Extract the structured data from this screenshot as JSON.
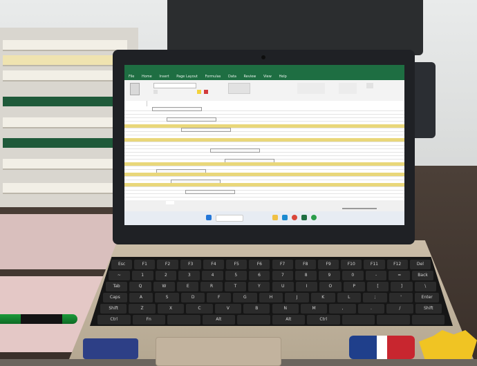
{
  "screen": {
    "app_title": "",
    "ribbon_tabs": [
      "File",
      "Home",
      "Insert",
      "Page Layout",
      "Formulas",
      "Data",
      "Review",
      "View",
      "Help"
    ],
    "sheet_tabs": [
      "",
      "",
      "",
      "",
      ""
    ],
    "accent_color": "#1e6e42",
    "highlight_row_color": "#e9d77a"
  },
  "icons": [
    "windows-start-icon",
    "search-icon",
    "file-explorer-icon",
    "edge-icon",
    "excel-icon"
  ],
  "keyboard": {
    "row1": [
      "Esc",
      "F1",
      "F2",
      "F3",
      "F4",
      "F5",
      "F6",
      "F7",
      "F8",
      "F9",
      "F10",
      "F11",
      "F12",
      "Del"
    ],
    "row2": [
      "~",
      "1",
      "2",
      "3",
      "4",
      "5",
      "6",
      "7",
      "8",
      "9",
      "0",
      "-",
      "=",
      "Back"
    ],
    "row3": [
      "Tab",
      "Q",
      "W",
      "E",
      "R",
      "T",
      "Y",
      "U",
      "I",
      "O",
      "P",
      "[",
      "]",
      "\\"
    ],
    "row4": [
      "Caps",
      "A",
      "S",
      "D",
      "F",
      "G",
      "H",
      "J",
      "K",
      "L",
      ";",
      "'",
      "Enter"
    ],
    "row5": [
      "Shift",
      "Z",
      "X",
      "C",
      "V",
      "B",
      "N",
      "M",
      ",",
      ".",
      "/",
      "Shift"
    ],
    "row6": [
      "Ctrl",
      "Fn",
      "",
      "Alt",
      "",
      "Alt",
      "Ctrl",
      "",
      "",
      ""
    ]
  }
}
